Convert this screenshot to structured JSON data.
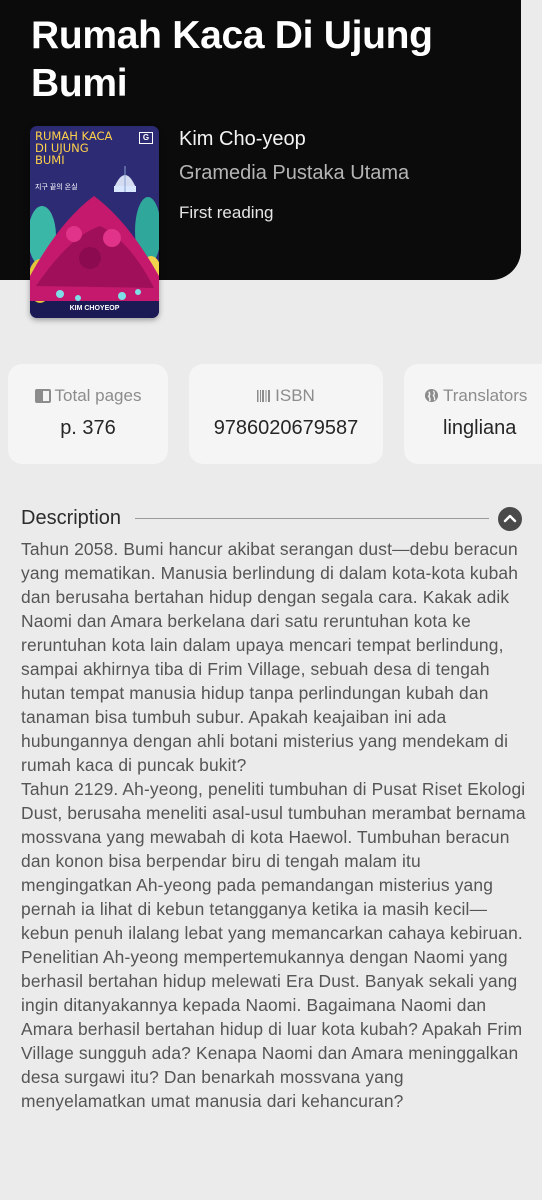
{
  "book": {
    "title": "Rumah Kaca Di Ujung Bumi",
    "author": "Kim Cho-yeop",
    "publisher": "Gramedia Pustaka Utama",
    "status": "First reading",
    "cover": {
      "title_text": "RUMAH KACA DI UJUNG BUMI",
      "subtitle_text": "지구 끝의 온실",
      "author_text": "KIM CHOYEOP",
      "publisher_logo": "G"
    }
  },
  "info_cards": [
    {
      "icon": "book-pages-icon",
      "label": "Total pages",
      "value": "p. 376"
    },
    {
      "icon": "barcode-icon",
      "label": "ISBN",
      "value": "9786020679587"
    },
    {
      "icon": "globe-icon",
      "label": "Translators",
      "value": "lingliana"
    }
  ],
  "description": {
    "heading": "Description",
    "text": "Tahun 2058. Bumi hancur akibat serangan dust—debu beracun yang mematikan. Manusia berlindung di dalam kota-kota kubah dan berusaha bertahan hidup dengan segala cara. Kakak adik Naomi dan Amara berkelana dari satu reruntuhan kota ke reruntuhan kota lain dalam upaya mencari tempat berlindung, sampai akhirnya tiba di Frim Village, sebuah desa di tengah hutan tempat manusia hidup tanpa perlindungan kubah dan tanaman bisa tumbuh subur. Apakah keajaiban ini ada hubungannya dengan ahli botani misterius yang mendekam di rumah kaca di puncak bukit?\nTahun 2129. Ah-yeong, peneliti tumbuhan di Pusat Riset Ekologi Dust, berusaha meneliti asal-usul tumbuhan merambat bernama mossvana yang mewabah di kota Haewol. Tumbuhan beracun dan konon bisa berpendar biru di tengah malam itu mengingatkan Ah-yeong pada pemandangan misterius yang pernah ia lihat di kebun tetangganya ketika ia masih kecil—kebun penuh ilalang lebat yang memancarkan cahaya kebiruan. Penelitian Ah-yeong mempertemukannya dengan Naomi yang berhasil bertahan hidup melewati Era Dust. Banyak sekali yang ingin ditanyakannya kepada Naomi. Bagaimana Naomi dan Amara berhasil bertahan hidup di luar kota kubah? Apakah Frim Village sungguh ada? Kenapa Naomi dan Amara meninggalkan desa surgawi itu? Dan benarkah mossvana yang menyelamatkan umat manusia dari kehancuran?"
  }
}
